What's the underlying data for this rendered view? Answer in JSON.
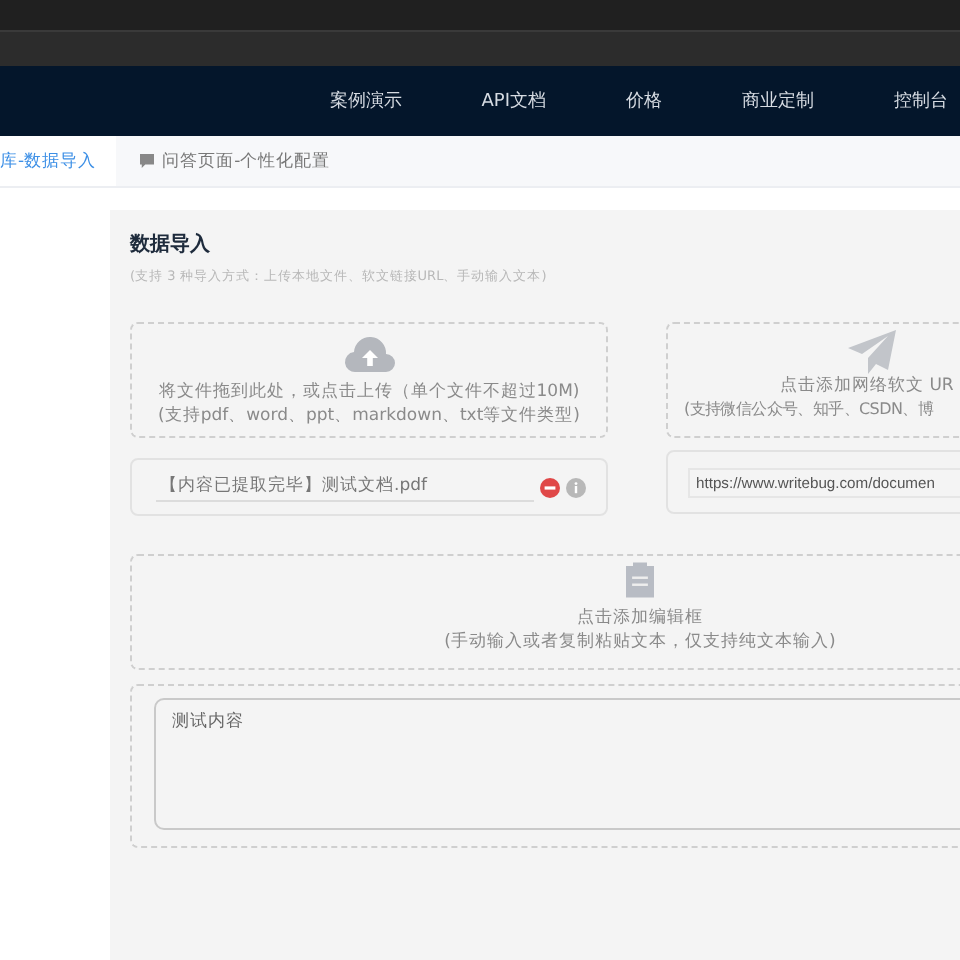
{
  "nav": {
    "items": [
      "案例演示",
      "API文档",
      "价格",
      "商业定制",
      "控制台"
    ]
  },
  "tabs": [
    {
      "label": "库-数据导入",
      "selected": true
    },
    {
      "label": "问答页面-个性化配置",
      "selected": false
    }
  ],
  "import_panel": {
    "title": "数据导入",
    "subtitle": "(支持 3 种导入方式：上传本地文件、软文链接URL、手动输入文本)",
    "upload": {
      "lines": [
        "将文件拖到此处，或点击上传（单个文件不超过10M)",
        "(支持pdf、word、ppt、markdown、txt等文件类型)"
      ]
    },
    "url_source": {
      "lines": [
        "点击添加网络软文 UR",
        "(支持微信公众号、知乎、CSDN、博"
      ]
    },
    "file_item": {
      "name": "【内容已提取完毕】测试文档.pdf"
    },
    "url_field": {
      "value": "https://www.writebug.com/documen"
    },
    "editor_source": {
      "lines": [
        "点击添加编辑框",
        "(手动输入或者复制粘贴文本，仅支持纯文本输入)"
      ]
    },
    "text_input": {
      "value": "测试内容"
    }
  }
}
